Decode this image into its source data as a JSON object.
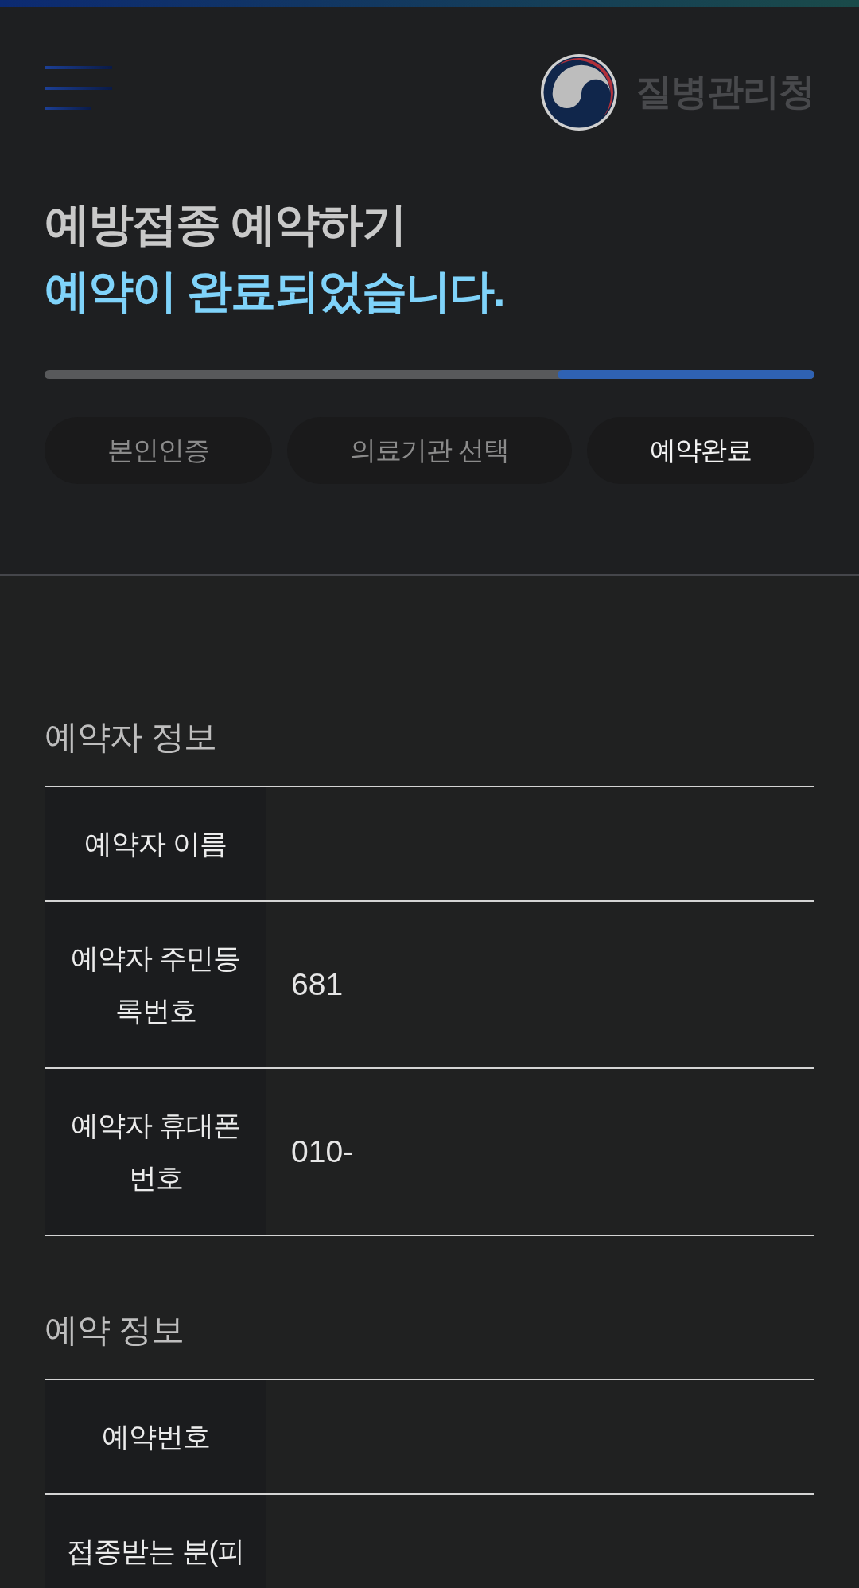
{
  "header": {
    "agency_name": "질병관리청"
  },
  "title": "예방접종 예약하기",
  "subtitle": "예약이 완료되었습니다.",
  "steps": [
    {
      "label": "본인인증",
      "selected": false
    },
    {
      "label": "의료기관 선택",
      "selected": false
    },
    {
      "label": "예약완료",
      "selected": true
    }
  ],
  "sections": [
    {
      "title": "예약자 정보",
      "rows": [
        {
          "label": "예약자 이름"
        },
        {
          "label": "예약자 주민등록번호",
          "value": "681"
        },
        {
          "label": "예약자 휴대폰 번호",
          "value": "010-"
        }
      ]
    },
    {
      "title": "예약 정보",
      "rows": [
        {
          "label": "예약번호"
        },
        {
          "label": "접종받는 분(피"
        }
      ]
    }
  ]
}
